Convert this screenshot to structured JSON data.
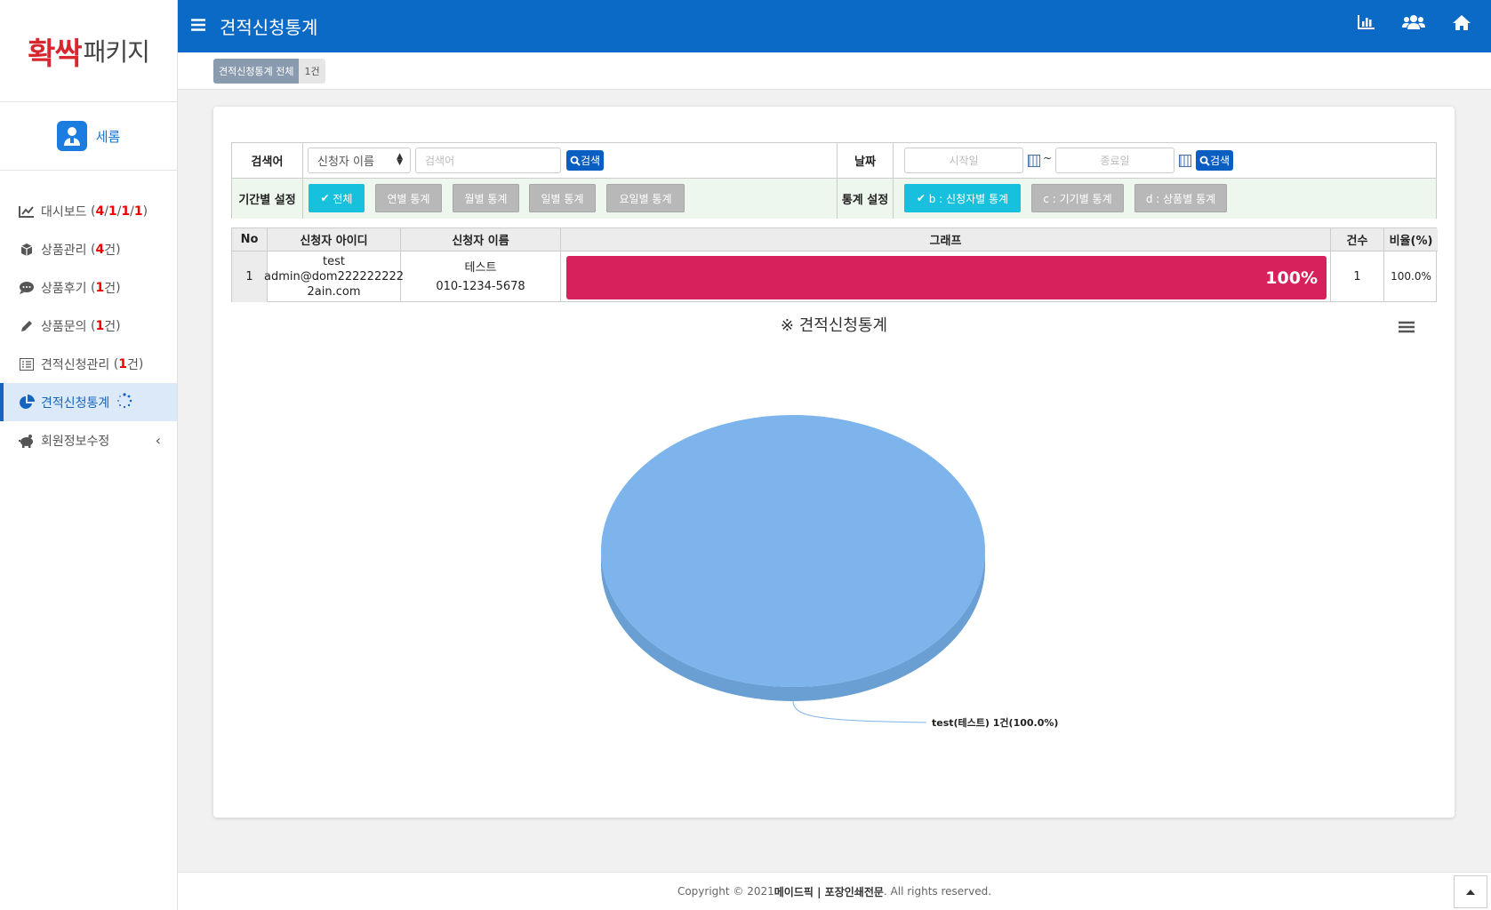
{
  "brand": {
    "logo_red": "확싹",
    "logo_gray": "패키지"
  },
  "user": {
    "name": "세롬"
  },
  "sidebar": {
    "items": [
      {
        "label": "대시보드",
        "counts": [
          "4",
          "1",
          "1",
          "1"
        ]
      },
      {
        "label": "상품관리",
        "count": "4",
        "unit": "건"
      },
      {
        "label": "상품후기",
        "count": "1",
        "unit": "건"
      },
      {
        "label": "상품문의",
        "count": "1",
        "unit": "건"
      },
      {
        "label": "견적신청관리",
        "count": "1",
        "unit": "건"
      },
      {
        "label": "견적신청통계"
      },
      {
        "label": "회원정보수정"
      }
    ]
  },
  "header": {
    "title": "견적신청통계"
  },
  "tab": {
    "label": "견적신청통계 전체",
    "count": "1건"
  },
  "search": {
    "keyword_label": "검색어",
    "select_value": "신청자 이름",
    "keyword_placeholder": "검색어",
    "search_button": "검색",
    "date_label": "날짜",
    "start_placeholder": "시작일",
    "tilde": "~",
    "end_placeholder": "종료일",
    "date_search_button": "검색",
    "period_label": "기간별 설정",
    "period_buttons": [
      "전체",
      "연별 통계",
      "월별 통계",
      "일별 통계",
      "요일별 통계"
    ],
    "stat_label": "통계 설정",
    "stat_buttons": [
      "b : 신청자별 통계",
      "c : 기기별 통계",
      "d : 상품별 통계"
    ]
  },
  "table": {
    "headers": [
      "No",
      "신청자 아이디",
      "신청자 이름",
      "그래프",
      "건수",
      "비율(%)"
    ],
    "rows": [
      {
        "no": "1",
        "id_lines": [
          "test",
          "admin@dom222222222",
          "2ain.com"
        ],
        "name_lines": [
          "테스트",
          "010-1234-5678"
        ],
        "bar_label": "100%",
        "bar_fraction": 1.0,
        "count": "1",
        "ratio": "100.0%"
      }
    ]
  },
  "chart_data": {
    "type": "pie",
    "title": "※ 견적신청통계",
    "slices": [
      {
        "label": "test(테스트) 1건(100.0%)",
        "value": 1,
        "percent": 100.0,
        "color": "#7cb4eb"
      }
    ]
  },
  "footer": {
    "prefix": "Copyright © 2021 ",
    "company": "메이드픽 | 포장인쇄전문",
    "suffix": ". All rights reserved."
  },
  "colors": {
    "header": "#0a6ac6",
    "bar": "#d6215c",
    "active_button": "#17c1de",
    "pie": "#7cb4eb"
  }
}
